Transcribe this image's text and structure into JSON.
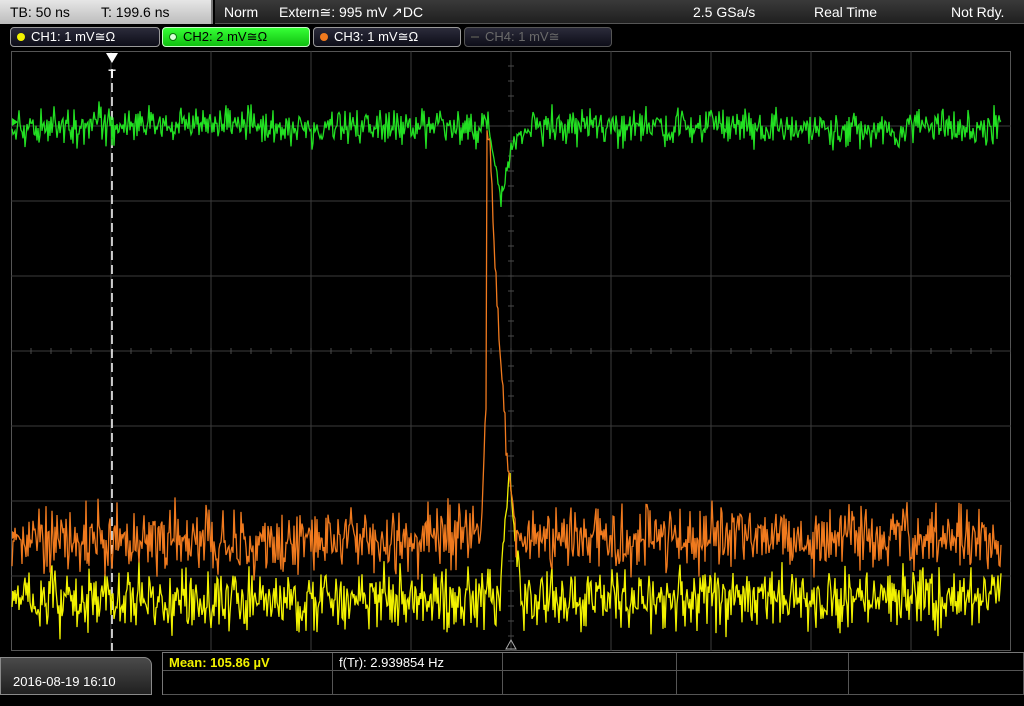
{
  "status": {
    "timebase": "TB: 50 ns",
    "trigger_time": "T: 199.6 ns",
    "mode": "Norm",
    "trigger": "Extern≅: 995 mV ↗DC",
    "sample_rate": "2.5 GSa/s",
    "acquisition": "Real Time",
    "state": "Not Rdy."
  },
  "channels": [
    {
      "label": "CH1: 1 mV≅Ω",
      "color": "#f2f200",
      "active": false,
      "enabled": true
    },
    {
      "label": "CH2: 2 mV≅Ω",
      "color": "#22e022",
      "active": true,
      "enabled": true
    },
    {
      "label": "CH3: 1 mV≅Ω",
      "color": "#f07a1e",
      "active": false,
      "enabled": true
    },
    {
      "label": "CH4: 1 mV≅",
      "color": "#555555",
      "active": false,
      "enabled": false
    }
  ],
  "markers": {
    "trigger_marker": "T"
  },
  "footer": {
    "datetime": "2016-08-19 16:10",
    "mean": "Mean: 105.86 µV",
    "frequency": "f(Tr): 2.939854 Hz"
  },
  "colors": {
    "ch1": "#f2f200",
    "ch2": "#22e022",
    "ch3": "#f07a1e",
    "grid": "#3c3c3c",
    "trigger_line": "#ffffff"
  },
  "icons": {
    "channel_dot": "filled-circle",
    "trigger_arrow": "down-triangle-icon",
    "bottom_marker": "up-triangle-icon"
  }
}
